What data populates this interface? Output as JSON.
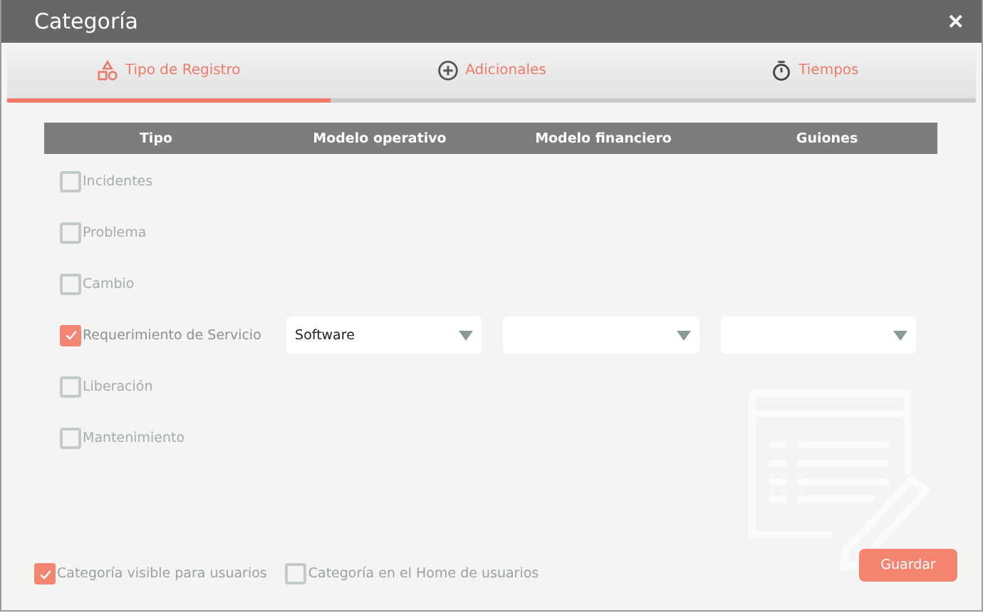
{
  "window": {
    "title": "Categoría",
    "close": "✕"
  },
  "tabs": [
    {
      "label": "Tipo de Registro",
      "selected": true
    },
    {
      "label": "Adicionales",
      "selected": false
    },
    {
      "label": "Tiempos",
      "selected": false
    }
  ],
  "table": {
    "columns": [
      "Tipo",
      "Modelo operativo",
      "Modelo financiero",
      "Guiones"
    ],
    "rows": [
      {
        "label": "Incidentes",
        "checked": false
      },
      {
        "label": "Problema",
        "checked": false
      },
      {
        "label": "Cambio",
        "checked": false
      },
      {
        "label": "Requerimiento de Servicio",
        "checked": true,
        "fields": [
          {
            "kind": "dropdown",
            "value": "Software"
          },
          {
            "kind": "dropdown"
          },
          {
            "kind": "dropdown"
          }
        ]
      },
      {
        "label": "Liberación",
        "checked": false
      },
      {
        "label": "Mantenimiento",
        "checked": false
      }
    ]
  },
  "options": [
    {
      "label": "Categoría visible para usuarios",
      "checked": true
    },
    {
      "label": "Categoría en el Home de usuarios",
      "checked": false
    }
  ],
  "buttons": [
    "Guardar"
  ]
}
